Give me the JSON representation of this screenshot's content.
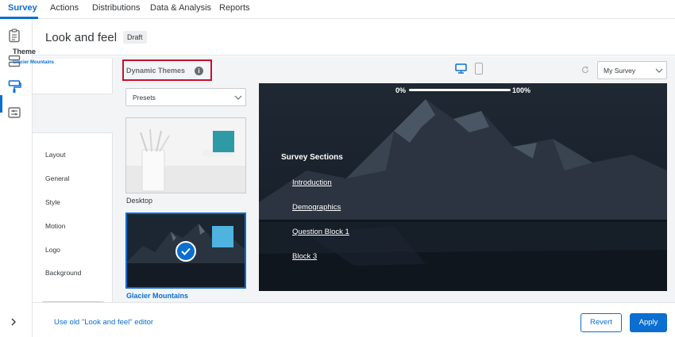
{
  "nav": {
    "tabs": [
      "Survey",
      "Actions",
      "Distributions",
      "Data & Analysis",
      "Reports"
    ],
    "active_index": 0
  },
  "rail": {
    "icons": [
      "survey-icon",
      "blocks-icon",
      "look-and-feel-icon",
      "survey-options-icon"
    ],
    "active_icon": "look-and-feel-icon",
    "expand_icon": "chevron-right-icon"
  },
  "header": {
    "title": "Look and feel",
    "badge": "Draft"
  },
  "settings": {
    "theme_label": "Theme",
    "theme_value": "Glacier Mountains",
    "items": [
      "Layout",
      "General",
      "Style",
      "Motion",
      "Logo",
      "Background"
    ]
  },
  "themes": {
    "heading": "Dynamic Themes",
    "info_glyph": "i",
    "dropdown_value": "Presets",
    "cards": [
      {
        "name": "Desktop",
        "swatch_color": "#2e9aa6",
        "selected": false
      },
      {
        "name": "Glacier Mountains",
        "swatch_color": "#4fb3e0",
        "selected": true
      }
    ]
  },
  "preview": {
    "devices": [
      "desktop-icon",
      "mobile-icon"
    ],
    "active_device": "desktop-icon",
    "survey_select_value": "My Survey",
    "progress_start": "0%",
    "progress_end": "100%",
    "sections_title": "Survey Sections",
    "sections": [
      "Introduction",
      "Demographics",
      "Question Block 1",
      "Block 3"
    ]
  },
  "footer": {
    "old_editor_link": "Use old \"Look and feel\" editor",
    "revert_label": "Revert",
    "apply_label": "Apply"
  },
  "colors": {
    "accent": "#0b6ed0",
    "highlight_box": "#c8102e"
  }
}
